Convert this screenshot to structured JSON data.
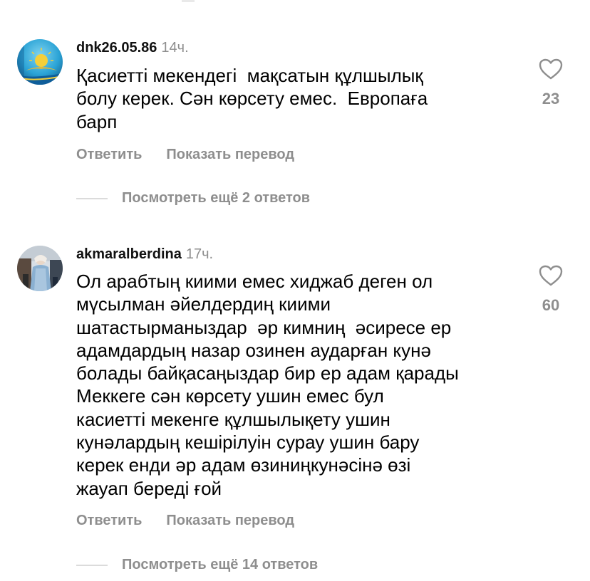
{
  "comments": [
    {
      "username": "dnk26.05.86",
      "time": "14ч.",
      "text_lines": [
        "Қасиетті мекендегі  мақсатын құлшылық",
        "болу керек. Сән көрсету емес.  Европаға",
        "барп"
      ],
      "likes": "23",
      "reply_label": "Ответить",
      "translate_label": "Показать перевод",
      "view_replies_label": "Посмотреть ещё 2 ответов",
      "avatar_icon": "kazakhstan-flag-avatar"
    },
    {
      "username": "akmaralberdina",
      "time": "17ч.",
      "text_lines": [
        "Ол арабтың киими емес хиджаб деген ол",
        "мүсылман әйелдердиң киими",
        "шатастырманыздар  әр кимниң  әсиресе ер",
        "адамдардың назар озинен аударған кунә",
        "болады байқасаңыздар бир ер адам қарады",
        "Меккеге сән көрсету ушин емес бул",
        "касиетті мекенге құлшылықету ушин",
        "кунәлардың кешірілуін сурау ушин бару",
        "керек енди әр адам өзиниңкунәсінә өзі",
        "жауап береді ғой"
      ],
      "likes": "60",
      "reply_label": "Ответить",
      "translate_label": "Показать перевод",
      "view_replies_label": "Посмотреть ещё 14 ответов",
      "avatar_icon": "user-photo-avatar"
    }
  ],
  "icons": {
    "heart": "heart-outline-icon"
  },
  "colors": {
    "text": "#000000",
    "secondary": "#8e8e8e",
    "divider": "#dbdbdb"
  }
}
